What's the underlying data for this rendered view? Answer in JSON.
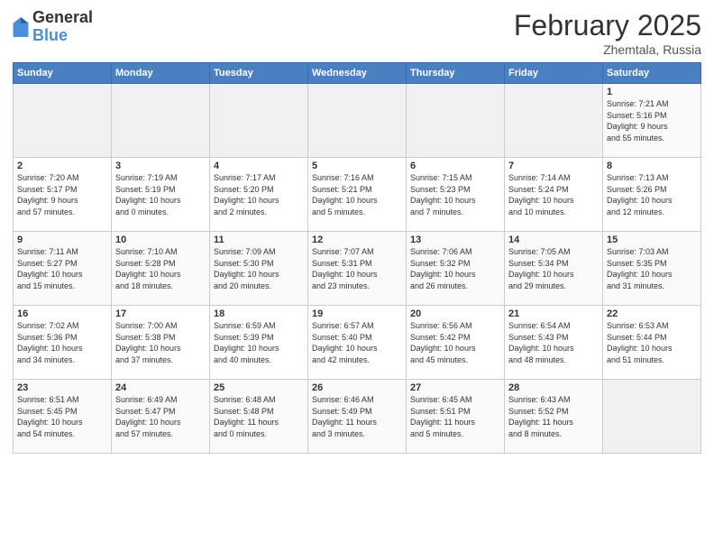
{
  "header": {
    "logo_general": "General",
    "logo_blue": "Blue",
    "month_title": "February 2025",
    "location": "Zhemtala, Russia"
  },
  "weekdays": [
    "Sunday",
    "Monday",
    "Tuesday",
    "Wednesday",
    "Thursday",
    "Friday",
    "Saturday"
  ],
  "weeks": [
    [
      {
        "day": "",
        "info": ""
      },
      {
        "day": "",
        "info": ""
      },
      {
        "day": "",
        "info": ""
      },
      {
        "day": "",
        "info": ""
      },
      {
        "day": "",
        "info": ""
      },
      {
        "day": "",
        "info": ""
      },
      {
        "day": "1",
        "info": "Sunrise: 7:21 AM\nSunset: 5:16 PM\nDaylight: 9 hours\nand 55 minutes."
      }
    ],
    [
      {
        "day": "2",
        "info": "Sunrise: 7:20 AM\nSunset: 5:17 PM\nDaylight: 9 hours\nand 57 minutes."
      },
      {
        "day": "3",
        "info": "Sunrise: 7:19 AM\nSunset: 5:19 PM\nDaylight: 10 hours\nand 0 minutes."
      },
      {
        "day": "4",
        "info": "Sunrise: 7:17 AM\nSunset: 5:20 PM\nDaylight: 10 hours\nand 2 minutes."
      },
      {
        "day": "5",
        "info": "Sunrise: 7:16 AM\nSunset: 5:21 PM\nDaylight: 10 hours\nand 5 minutes."
      },
      {
        "day": "6",
        "info": "Sunrise: 7:15 AM\nSunset: 5:23 PM\nDaylight: 10 hours\nand 7 minutes."
      },
      {
        "day": "7",
        "info": "Sunrise: 7:14 AM\nSunset: 5:24 PM\nDaylight: 10 hours\nand 10 minutes."
      },
      {
        "day": "8",
        "info": "Sunrise: 7:13 AM\nSunset: 5:26 PM\nDaylight: 10 hours\nand 12 minutes."
      }
    ],
    [
      {
        "day": "9",
        "info": "Sunrise: 7:11 AM\nSunset: 5:27 PM\nDaylight: 10 hours\nand 15 minutes."
      },
      {
        "day": "10",
        "info": "Sunrise: 7:10 AM\nSunset: 5:28 PM\nDaylight: 10 hours\nand 18 minutes."
      },
      {
        "day": "11",
        "info": "Sunrise: 7:09 AM\nSunset: 5:30 PM\nDaylight: 10 hours\nand 20 minutes."
      },
      {
        "day": "12",
        "info": "Sunrise: 7:07 AM\nSunset: 5:31 PM\nDaylight: 10 hours\nand 23 minutes."
      },
      {
        "day": "13",
        "info": "Sunrise: 7:06 AM\nSunset: 5:32 PM\nDaylight: 10 hours\nand 26 minutes."
      },
      {
        "day": "14",
        "info": "Sunrise: 7:05 AM\nSunset: 5:34 PM\nDaylight: 10 hours\nand 29 minutes."
      },
      {
        "day": "15",
        "info": "Sunrise: 7:03 AM\nSunset: 5:35 PM\nDaylight: 10 hours\nand 31 minutes."
      }
    ],
    [
      {
        "day": "16",
        "info": "Sunrise: 7:02 AM\nSunset: 5:36 PM\nDaylight: 10 hours\nand 34 minutes."
      },
      {
        "day": "17",
        "info": "Sunrise: 7:00 AM\nSunset: 5:38 PM\nDaylight: 10 hours\nand 37 minutes."
      },
      {
        "day": "18",
        "info": "Sunrise: 6:59 AM\nSunset: 5:39 PM\nDaylight: 10 hours\nand 40 minutes."
      },
      {
        "day": "19",
        "info": "Sunrise: 6:57 AM\nSunset: 5:40 PM\nDaylight: 10 hours\nand 42 minutes."
      },
      {
        "day": "20",
        "info": "Sunrise: 6:56 AM\nSunset: 5:42 PM\nDaylight: 10 hours\nand 45 minutes."
      },
      {
        "day": "21",
        "info": "Sunrise: 6:54 AM\nSunset: 5:43 PM\nDaylight: 10 hours\nand 48 minutes."
      },
      {
        "day": "22",
        "info": "Sunrise: 6:53 AM\nSunset: 5:44 PM\nDaylight: 10 hours\nand 51 minutes."
      }
    ],
    [
      {
        "day": "23",
        "info": "Sunrise: 6:51 AM\nSunset: 5:45 PM\nDaylight: 10 hours\nand 54 minutes."
      },
      {
        "day": "24",
        "info": "Sunrise: 6:49 AM\nSunset: 5:47 PM\nDaylight: 10 hours\nand 57 minutes."
      },
      {
        "day": "25",
        "info": "Sunrise: 6:48 AM\nSunset: 5:48 PM\nDaylight: 11 hours\nand 0 minutes."
      },
      {
        "day": "26",
        "info": "Sunrise: 6:46 AM\nSunset: 5:49 PM\nDaylight: 11 hours\nand 3 minutes."
      },
      {
        "day": "27",
        "info": "Sunrise: 6:45 AM\nSunset: 5:51 PM\nDaylight: 11 hours\nand 5 minutes."
      },
      {
        "day": "28",
        "info": "Sunrise: 6:43 AM\nSunset: 5:52 PM\nDaylight: 11 hours\nand 8 minutes."
      },
      {
        "day": "",
        "info": ""
      }
    ]
  ]
}
